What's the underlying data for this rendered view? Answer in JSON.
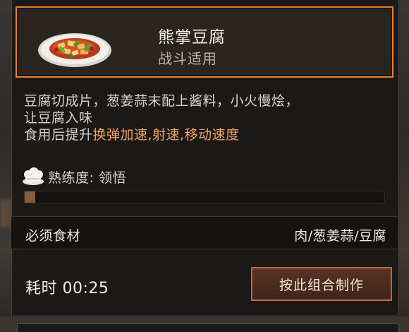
{
  "dish": {
    "name": "熊掌豆腐",
    "tag": "战斗适用",
    "icon": "mapo-tofu-plate-icon"
  },
  "description": {
    "line1": "豆腐切成片，葱姜蒜末配上酱料，小火慢烩，",
    "line2": "让豆腐入味",
    "effect_prefix": "食用后提升",
    "effect_highlight": "换弹加速,射速,移动速度"
  },
  "mastery": {
    "icon": "chef-hat-icon",
    "label": "熟练度: 领悟",
    "progress_fraction": 0.03
  },
  "ingredients": {
    "label": "必须食材",
    "value": "肉/葱姜蒜/豆腐"
  },
  "timing": {
    "label": "耗时 00:25"
  },
  "actions": {
    "craft_label": "按此组合制作"
  },
  "colors": {
    "accent_orange": "#e9802a",
    "highlight_text": "#f0a25a",
    "button_border": "#b66a3f",
    "panel_bg": "#1a1817"
  }
}
